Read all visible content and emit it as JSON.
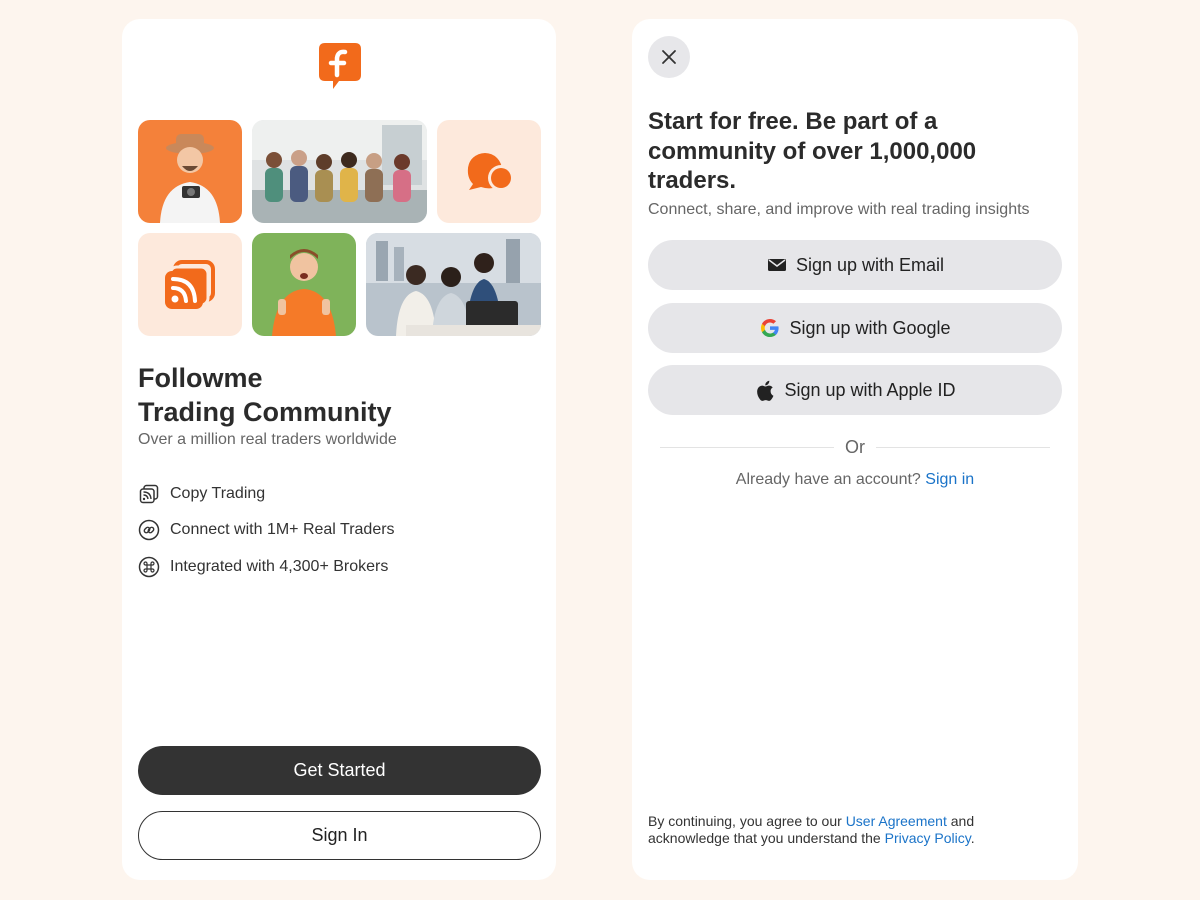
{
  "brand": {
    "accent": "#f26a1b",
    "peach": "#fde9dc",
    "dark_button": "#333333",
    "link": "#1a73c8"
  },
  "left_panel": {
    "logo_icon": "followme-f-logo",
    "title_line1": "Followme",
    "title_line2": "Trading Community",
    "subtitle": "Over a million real traders worldwide",
    "features": [
      {
        "icon": "copy-trading-icon",
        "label": "Copy Trading"
      },
      {
        "icon": "link-icon",
        "label": "Connect with 1M+ Real Traders"
      },
      {
        "icon": "command-icon",
        "label": "Integrated with 4,300+ Brokers"
      }
    ],
    "get_started_label": "Get Started",
    "sign_in_label": "Sign In"
  },
  "right_panel": {
    "close_icon": "close-icon",
    "heading": "Start for free. Be part of a community of over 1,000,000 traders.",
    "subheading": "Connect, share, and improve with real trading insights",
    "buttons": [
      {
        "icon": "email-icon",
        "label": "Sign up with Email"
      },
      {
        "icon": "google-icon",
        "label": "Sign up with Google"
      },
      {
        "icon": "apple-icon",
        "label": "Sign up with Apple ID"
      }
    ],
    "or_label": "Or",
    "already_text": "Already have an account?",
    "sign_in_link": "Sign in",
    "legal_prefix": "By continuing, you agree to our",
    "user_agreement": "User Agreement",
    "legal_middle": "and acknowledge that you understand the",
    "privacy_policy": "Privacy Policy",
    "legal_suffix": "."
  }
}
